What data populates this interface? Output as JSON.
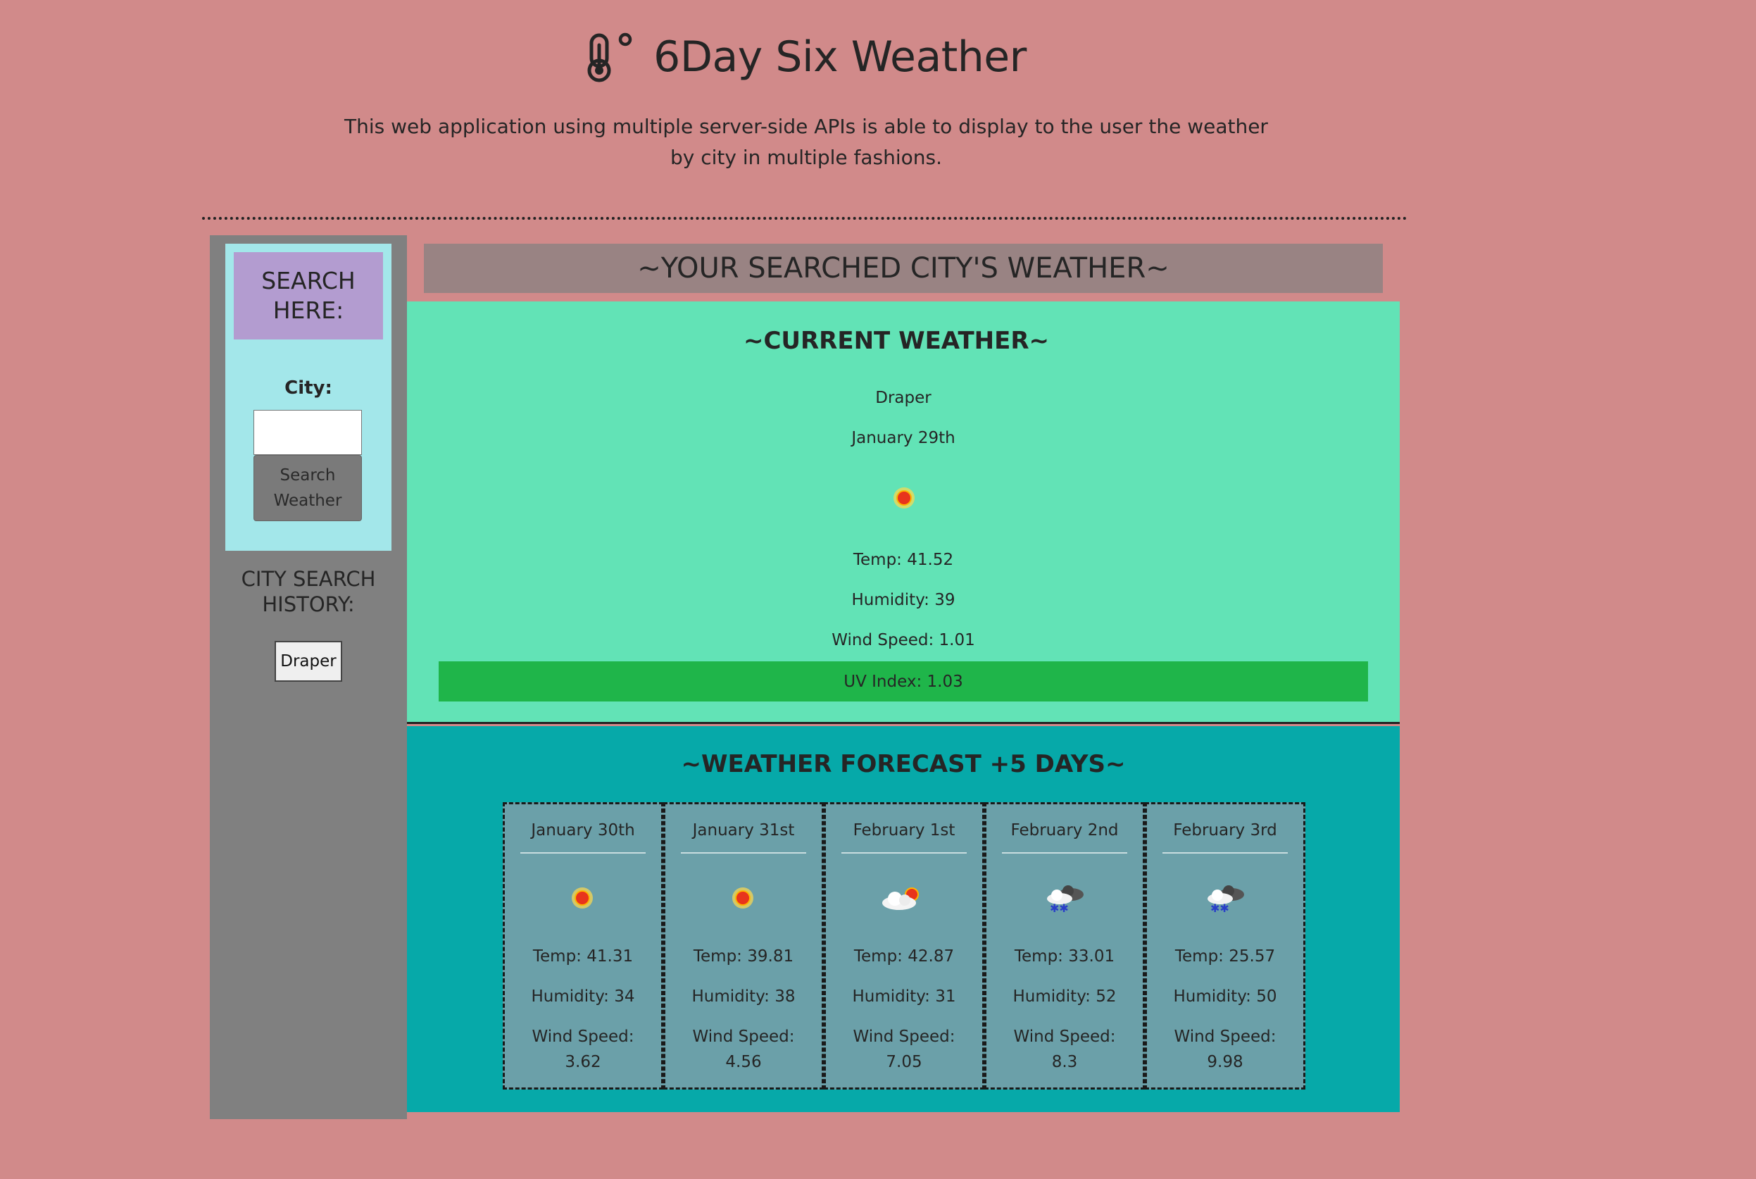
{
  "header": {
    "title": "6Day Six Weather",
    "subtitle": "This web application using multiple server-side APIs is able to display to the user the weather by city in multiple fashions."
  },
  "sidebar": {
    "search_header": "SEARCH HERE:",
    "city_label": "City:",
    "city_value": "",
    "search_button": "Search Weather",
    "history_title": "CITY SEARCH HISTORY:",
    "history": [
      "Draper"
    ]
  },
  "main": {
    "header": "~YOUR SEARCHED CITY'S WEATHER~",
    "current": {
      "title": "~CURRENT WEATHER~",
      "city": "Draper",
      "date": "January 29th",
      "icon": "sun-icon",
      "temp": "Temp: 41.52",
      "humidity": "Humidity: 39",
      "wind": "Wind Speed: 1.01",
      "uv": "UV Index: 1.03",
      "uv_color": "#1fb54a"
    },
    "forecast": {
      "title": "~WEATHER FORECAST +5 DAYS~",
      "days": [
        {
          "date": "January 30th",
          "icon": "sun-icon",
          "temp": "Temp: 41.31",
          "humidity": "Humidity: 34",
          "wind_label": "Wind Speed:",
          "wind": "3.62"
        },
        {
          "date": "January 31st",
          "icon": "sun-icon",
          "temp": "Temp: 39.81",
          "humidity": "Humidity: 38",
          "wind_label": "Wind Speed:",
          "wind": "4.56"
        },
        {
          "date": "February 1st",
          "icon": "partly-cloudy-icon",
          "temp": "Temp: 42.87",
          "humidity": "Humidity: 31",
          "wind_label": "Wind Speed:",
          "wind": "7.05"
        },
        {
          "date": "February 2nd",
          "icon": "snow-cloud-icon",
          "temp": "Temp: 33.01",
          "humidity": "Humidity: 52",
          "wind_label": "Wind Speed:",
          "wind": "8.3"
        },
        {
          "date": "February 3rd",
          "icon": "snow-cloud-icon",
          "temp": "Temp: 25.57",
          "humidity": "Humidity: 50",
          "wind_label": "Wind Speed:",
          "wind": "9.98"
        }
      ]
    }
  },
  "colors": {
    "page_bg": "#d18a8a",
    "sidebar_bg": "#808080",
    "search_box_bg": "#a3e7ea",
    "search_header_bg": "#b39cd0",
    "main_header_bg": "#998383",
    "current_bg": "#62e3b6",
    "forecast_bg": "#06a9a9",
    "card_bg": "#6ba0a9"
  }
}
